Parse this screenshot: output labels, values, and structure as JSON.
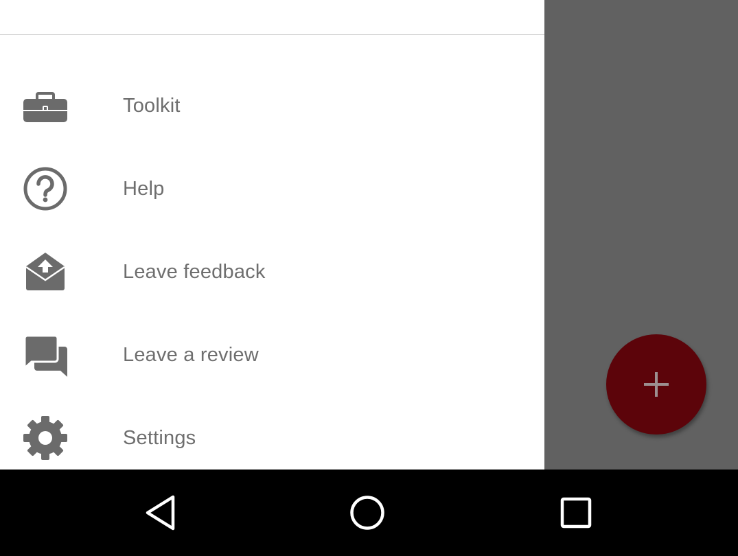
{
  "drawer": {
    "items": [
      {
        "label": "Toolkit",
        "icon": "briefcase-icon"
      },
      {
        "label": "Help",
        "icon": "help-circle-icon"
      },
      {
        "label": "Leave feedback",
        "icon": "mail-upload-icon"
      },
      {
        "label": "Leave a review",
        "icon": "chat-bubbles-icon"
      },
      {
        "label": "Settings",
        "icon": "gear-icon"
      }
    ],
    "icon_color": "#6b6b6b",
    "label_color": "#6e6e6e"
  },
  "fab": {
    "icon": "plus-icon",
    "color": "#5c040a"
  },
  "scrim_color": "#616161",
  "navigation_bar": {
    "buttons": [
      {
        "icon": "back-triangle-icon"
      },
      {
        "icon": "home-circle-icon"
      },
      {
        "icon": "recents-square-icon"
      }
    ]
  }
}
